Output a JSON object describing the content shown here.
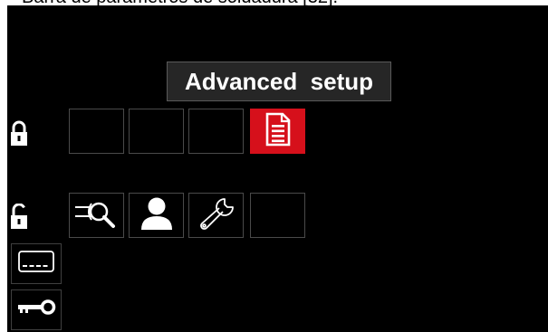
{
  "caption": "Barra de parâmetros de soldadura [32].",
  "title": "Advanced  setup",
  "rows": {
    "locked": {
      "icon": "lock-closed-icon",
      "tiles": [
        {
          "icon": "",
          "selected": false
        },
        {
          "icon": "",
          "selected": false
        },
        {
          "icon": "",
          "selected": false
        },
        {
          "icon": "document-icon",
          "selected": true
        }
      ]
    },
    "unlocked": {
      "icon": "lock-open-icon",
      "tiles": [
        {
          "icon": "torch-search-icon",
          "selected": false
        },
        {
          "icon": "user-icon",
          "selected": false
        },
        {
          "icon": "wrench-icon",
          "selected": false
        },
        {
          "icon": "",
          "selected": false
        }
      ]
    }
  },
  "side_buttons": [
    {
      "icon": "display-icon"
    },
    {
      "icon": "key-icon"
    }
  ],
  "colors": {
    "screen_background": "#000000",
    "selected_tile": "#d6101b",
    "tile_border": "#4a4a4a",
    "title_background": "#262626"
  }
}
